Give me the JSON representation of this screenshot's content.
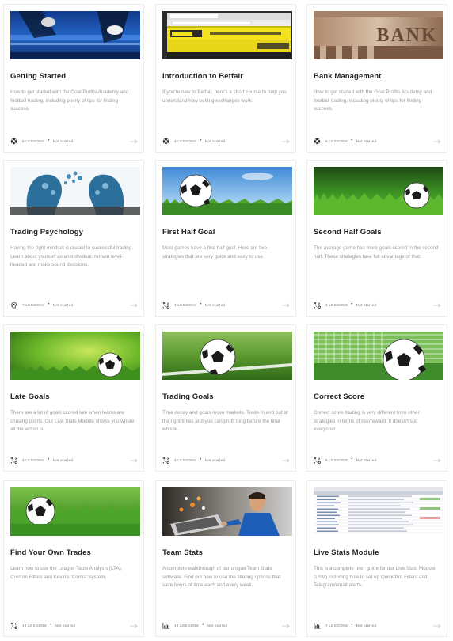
{
  "courses": [
    {
      "title": "Getting Started",
      "description": "How to get started with the Goal Profits Academy and football trading, including plenty of tips for finding success.",
      "lessons": "6 LESSONS",
      "status": "Not started",
      "icon": "soccer-ball-icon",
      "image": "stadium-players"
    },
    {
      "title": "Introduction to Betfair",
      "description": "If you're new to Betfair, here's a short course to help you understand how betting exchanges work.",
      "lessons": "4 LESSONS",
      "status": "Not started",
      "icon": "soccer-ball-icon",
      "image": "betfair-browser"
    },
    {
      "title": "Bank Management",
      "description": "How to get started with the Goal Profits Academy and football trading, including plenty of tips for finding success.",
      "lessons": "5 LESSONS",
      "status": "Not started",
      "icon": "soccer-ball-icon",
      "image": "bank-building",
      "image_text": "BANK"
    },
    {
      "title": "Trading Psychology",
      "description": "Having the right mindset is crucial to successful trading. Learn about yourself as an individual, remain level-headed and make sound decisions.",
      "lessons": "7 LESSONS",
      "status": "Not started",
      "icon": "head-lightbulb-icon",
      "image": "gear-heads"
    },
    {
      "title": "First Half Goal",
      "description": "Most games have a first half goal. Here are two strategies that are very quick and easy to use.",
      "lessons": "4 LESSONS",
      "status": "Not started",
      "icon": "tactics-icon",
      "image": "ball-sky"
    },
    {
      "title": "Second Half Goals",
      "description": "The average game has more goals scored in the second half. These strategies take full advantage of that.",
      "lessons": "4 LESSONS",
      "status": "Not started",
      "icon": "tactics-icon",
      "image": "ball-grass-right"
    },
    {
      "title": "Late Goals",
      "description": "There are a lot of goals scored late when teams are chasing points. Our Live Stats Module shows you where all the action is.",
      "lessons": "4 LESSONS",
      "status": "Not started",
      "icon": "tactics-icon",
      "image": "ball-green-bokeh"
    },
    {
      "title": "Trading Goals",
      "description": "Time decay and goals move markets. Trade in and out at the right times and you can profit long before the final whistle.",
      "lessons": "4 LESSONS",
      "status": "Not started",
      "icon": "tactics-icon",
      "image": "ball-pitch-line"
    },
    {
      "title": "Correct Score",
      "description": "Correct score trading is very different from other strategies in terms of risk/reward. It doesn't suit everyone!",
      "lessons": "5 LESSONS",
      "status": "Not started",
      "icon": "tactics-icon",
      "image": "ball-net"
    },
    {
      "title": "Find Your Own Trades",
      "description": "Learn how to use the League Table Analysis (LTA), Custom Filters and Kevin's 'Contra' system.",
      "lessons": "16 LESSONS",
      "status": "Not started",
      "icon": "tactics-icon",
      "image": "ball-grass-left"
    },
    {
      "title": "Team Stats",
      "description": "A complete walkthrough of our unique Team Stats software. Find out how to use the filtering options that save hours of time each and every week.",
      "lessons": "18 LESSONS",
      "status": "Not started",
      "icon": "bar-chart-icon",
      "image": "man-laptop"
    },
    {
      "title": "Live Stats Module",
      "description": "This is a complete user guide for our Live Stats Module (LSM) including how to set up Quick/Pro Filters and Telegram/email alerts.",
      "lessons": "7 LESSONS",
      "status": "Not started",
      "icon": "bar-chart-icon",
      "image": "stats-table"
    }
  ],
  "colors": {
    "title": "#222222",
    "description": "#9a9a9a",
    "border": "#ececec",
    "arrow": "#d0d0d0"
  }
}
